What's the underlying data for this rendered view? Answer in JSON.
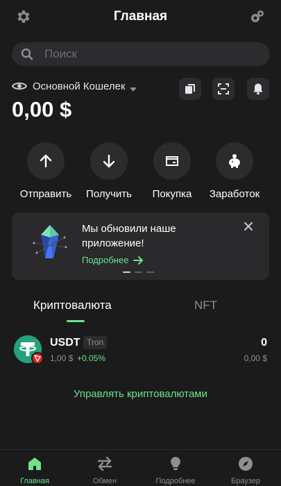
{
  "header": {
    "title": "Главная",
    "left_icon": "gear-icon",
    "right_icon": "wallet-connect-icon"
  },
  "search": {
    "placeholder": "Поиск"
  },
  "wallet": {
    "name": "Основной Кошелек",
    "balance": "0,00 $",
    "actions_icons": [
      "copy-icon",
      "scan-icon",
      "bell-icon"
    ]
  },
  "actions": [
    {
      "label": "Отправить",
      "icon": "arrow-up-icon"
    },
    {
      "label": "Получить",
      "icon": "arrow-down-icon"
    },
    {
      "label": "Покупка",
      "icon": "card-icon"
    },
    {
      "label": "Заработок",
      "icon": "piggy-bank-icon"
    }
  ],
  "banner": {
    "text": "Мы обновили наше приложение!",
    "link": "Подробнее",
    "slides": 3,
    "active_slide": 1
  },
  "tabs": [
    {
      "label": "Криптовалюта",
      "active": true
    },
    {
      "label": "NFT",
      "active": false
    }
  ],
  "tokens": [
    {
      "symbol": "USDT",
      "network": "Tron",
      "price": "1,00 $",
      "change": "+0.05%",
      "amount": "0",
      "value": "0,00 $"
    }
  ],
  "manage_label": "Управлять криптовалютами",
  "bottom_nav": [
    {
      "label": "Главная",
      "icon": "home-icon",
      "active": true
    },
    {
      "label": "Обмен",
      "icon": "swap-icon",
      "active": false
    },
    {
      "label": "Подробнее",
      "icon": "lightbulb-icon",
      "active": false
    },
    {
      "label": "Браузер",
      "icon": "compass-icon",
      "active": false
    }
  ],
  "colors": {
    "accent": "#6ee28c",
    "background": "#1b1b1c",
    "surface": "#2c2c2e"
  }
}
